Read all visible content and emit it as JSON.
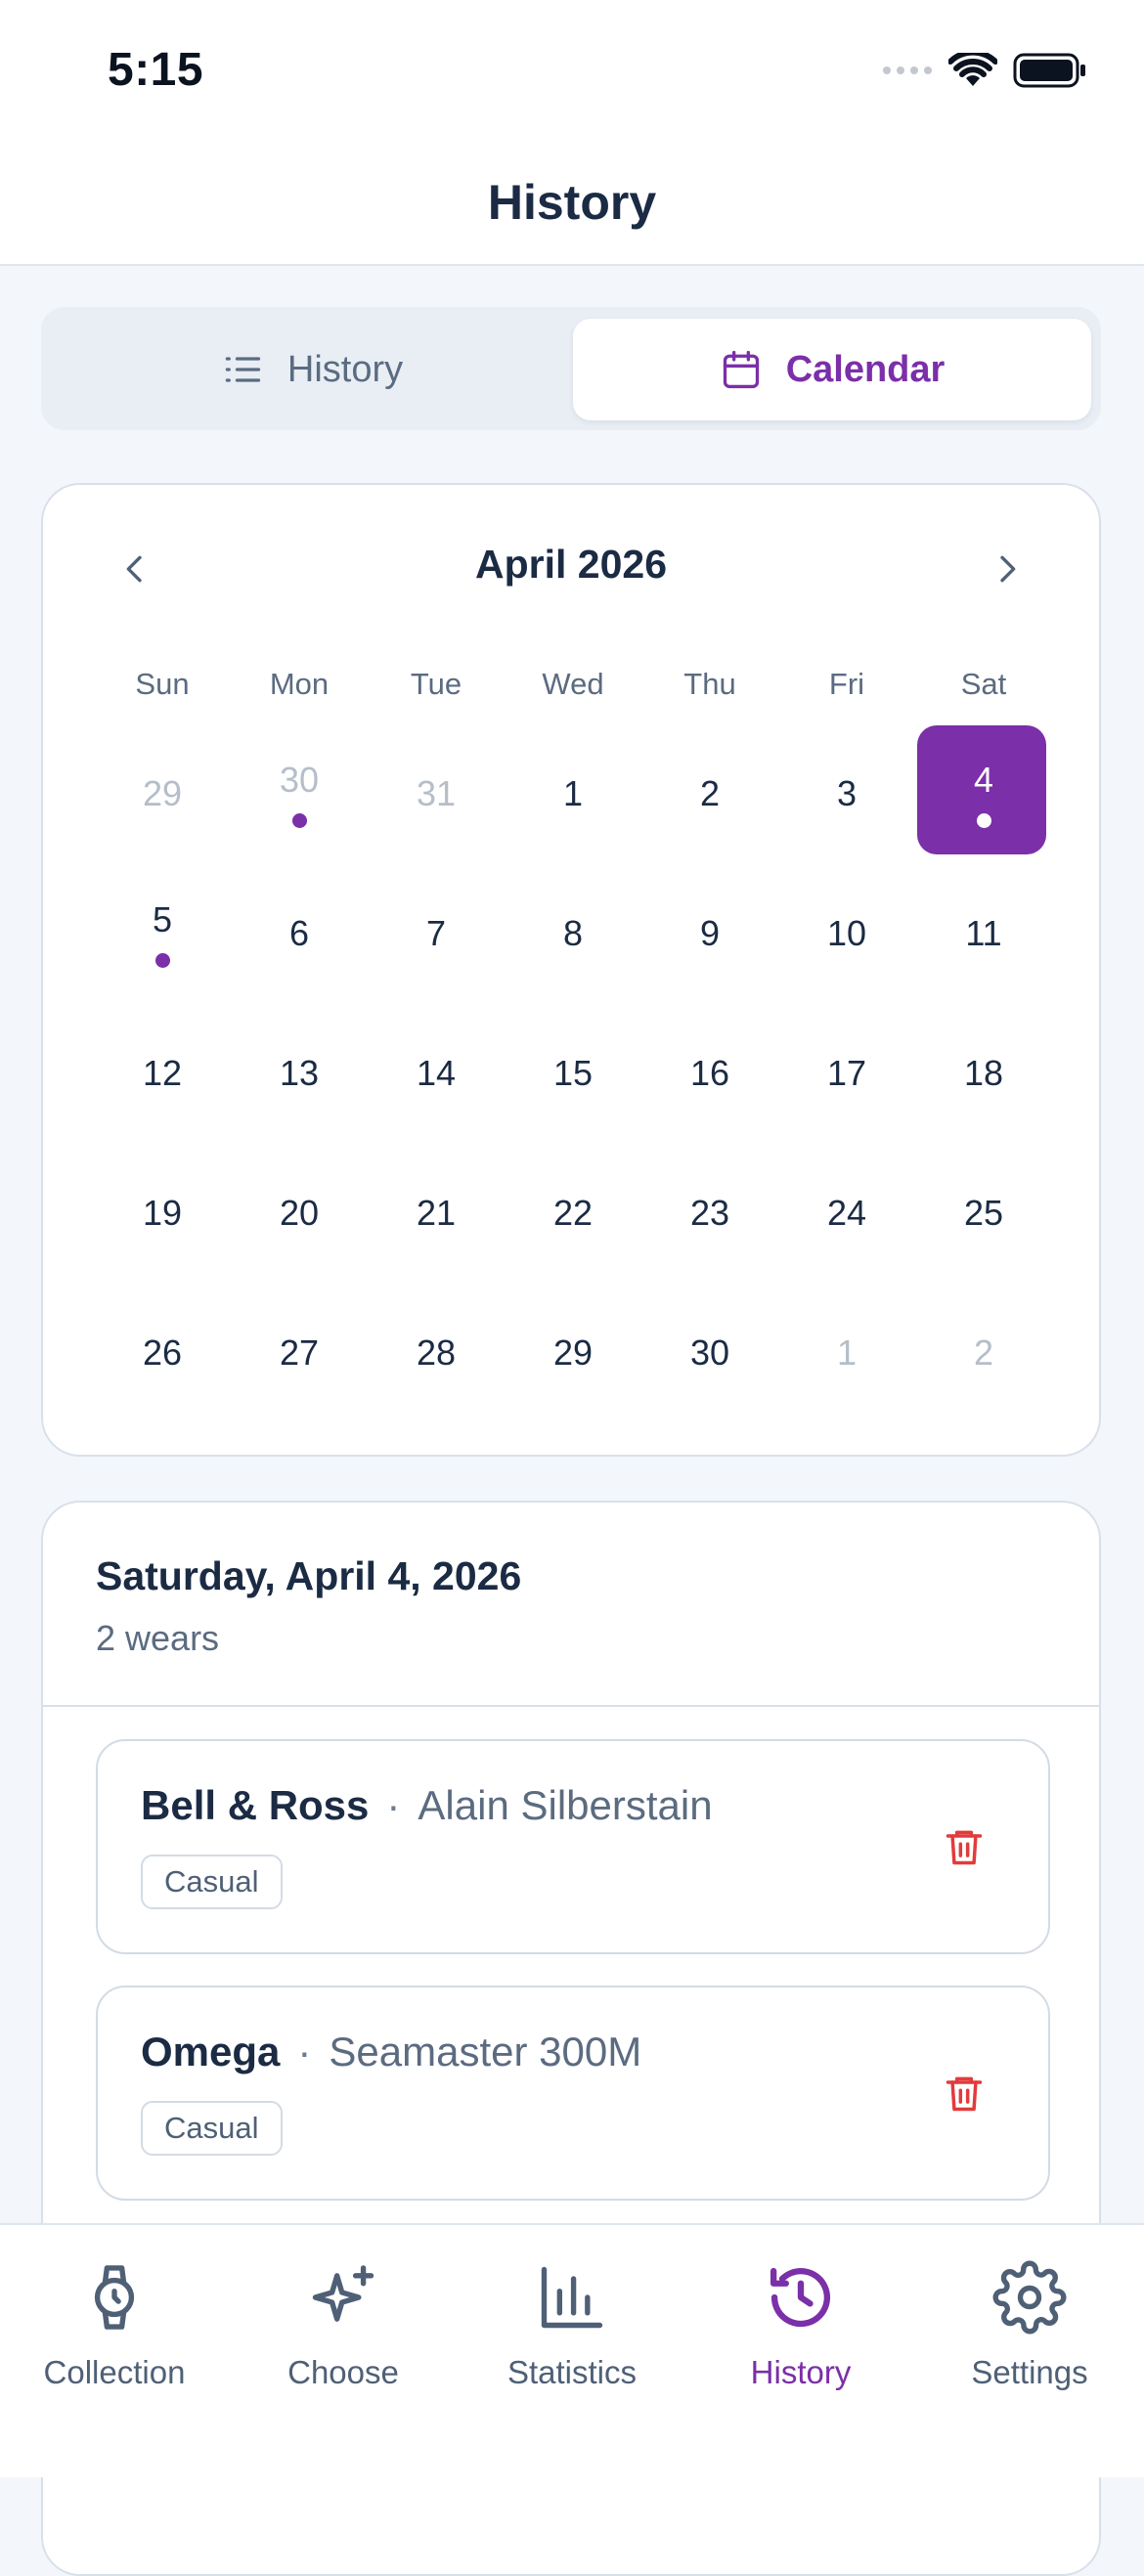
{
  "status_bar": {
    "time": "5:15"
  },
  "header": {
    "title": "History"
  },
  "segments": [
    {
      "label": "History",
      "icon": "list-icon",
      "selected": false
    },
    {
      "label": "Calendar",
      "icon": "calendar-icon",
      "selected": true
    }
  ],
  "calendar": {
    "month_label": "April 2026",
    "weekdays": [
      "Sun",
      "Mon",
      "Tue",
      "Wed",
      "Thu",
      "Fri",
      "Sat"
    ],
    "days": [
      {
        "label": "29",
        "current_month": false,
        "has_wear": false,
        "selected": false
      },
      {
        "label": "30",
        "current_month": false,
        "has_wear": true,
        "selected": false
      },
      {
        "label": "31",
        "current_month": false,
        "has_wear": false,
        "selected": false
      },
      {
        "label": "1",
        "current_month": true,
        "has_wear": false,
        "selected": false
      },
      {
        "label": "2",
        "current_month": true,
        "has_wear": false,
        "selected": false
      },
      {
        "label": "3",
        "current_month": true,
        "has_wear": false,
        "selected": false
      },
      {
        "label": "4",
        "current_month": true,
        "has_wear": true,
        "selected": true
      },
      {
        "label": "5",
        "current_month": true,
        "has_wear": true,
        "selected": false
      },
      {
        "label": "6",
        "current_month": true,
        "has_wear": false,
        "selected": false
      },
      {
        "label": "7",
        "current_month": true,
        "has_wear": false,
        "selected": false
      },
      {
        "label": "8",
        "current_month": true,
        "has_wear": false,
        "selected": false
      },
      {
        "label": "9",
        "current_month": true,
        "has_wear": false,
        "selected": false
      },
      {
        "label": "10",
        "current_month": true,
        "has_wear": false,
        "selected": false
      },
      {
        "label": "11",
        "current_month": true,
        "has_wear": false,
        "selected": false
      },
      {
        "label": "12",
        "current_month": true,
        "has_wear": false,
        "selected": false
      },
      {
        "label": "13",
        "current_month": true,
        "has_wear": false,
        "selected": false
      },
      {
        "label": "14",
        "current_month": true,
        "has_wear": false,
        "selected": false
      },
      {
        "label": "15",
        "current_month": true,
        "has_wear": false,
        "selected": false
      },
      {
        "label": "16",
        "current_month": true,
        "has_wear": false,
        "selected": false
      },
      {
        "label": "17",
        "current_month": true,
        "has_wear": false,
        "selected": false
      },
      {
        "label": "18",
        "current_month": true,
        "has_wear": false,
        "selected": false
      },
      {
        "label": "19",
        "current_month": true,
        "has_wear": false,
        "selected": false
      },
      {
        "label": "20",
        "current_month": true,
        "has_wear": false,
        "selected": false
      },
      {
        "label": "21",
        "current_month": true,
        "has_wear": false,
        "selected": false
      },
      {
        "label": "22",
        "current_month": true,
        "has_wear": false,
        "selected": false
      },
      {
        "label": "23",
        "current_month": true,
        "has_wear": false,
        "selected": false
      },
      {
        "label": "24",
        "current_month": true,
        "has_wear": false,
        "selected": false
      },
      {
        "label": "25",
        "current_month": true,
        "has_wear": false,
        "selected": false
      },
      {
        "label": "26",
        "current_month": true,
        "has_wear": false,
        "selected": false
      },
      {
        "label": "27",
        "current_month": true,
        "has_wear": false,
        "selected": false
      },
      {
        "label": "28",
        "current_month": true,
        "has_wear": false,
        "selected": false
      },
      {
        "label": "29",
        "current_month": true,
        "has_wear": false,
        "selected": false
      },
      {
        "label": "30",
        "current_month": true,
        "has_wear": false,
        "selected": false
      },
      {
        "label": "1",
        "current_month": false,
        "has_wear": false,
        "selected": false
      },
      {
        "label": "2",
        "current_month": false,
        "has_wear": false,
        "selected": false
      }
    ]
  },
  "selected_day": {
    "date_label": "Saturday, April 4, 2026",
    "count_label": "2 wears",
    "wears": [
      {
        "brand": "Bell & Ross",
        "separator": "·",
        "model": "Alain Silberstain",
        "tag": "Casual"
      },
      {
        "brand": "Omega",
        "separator": "·",
        "model": "Seamaster 300M",
        "tag": "Casual"
      }
    ]
  },
  "tab_bar": {
    "tabs": [
      {
        "label": "Collection",
        "icon": "watch-icon",
        "active": false
      },
      {
        "label": "Choose",
        "icon": "sparkles-icon",
        "active": false
      },
      {
        "label": "Statistics",
        "icon": "bar-chart-icon",
        "active": false
      },
      {
        "label": "History",
        "icon": "history-icon",
        "active": true
      },
      {
        "label": "Settings",
        "icon": "gear-icon",
        "active": false
      }
    ]
  },
  "colors": {
    "accent": "#7b2fa8",
    "text_primary": "#1b2b44",
    "text_secondary": "#5b6b80",
    "muted_day": "#b5bec9",
    "delete": "#e23b3b",
    "background": "#f3f6fa"
  }
}
